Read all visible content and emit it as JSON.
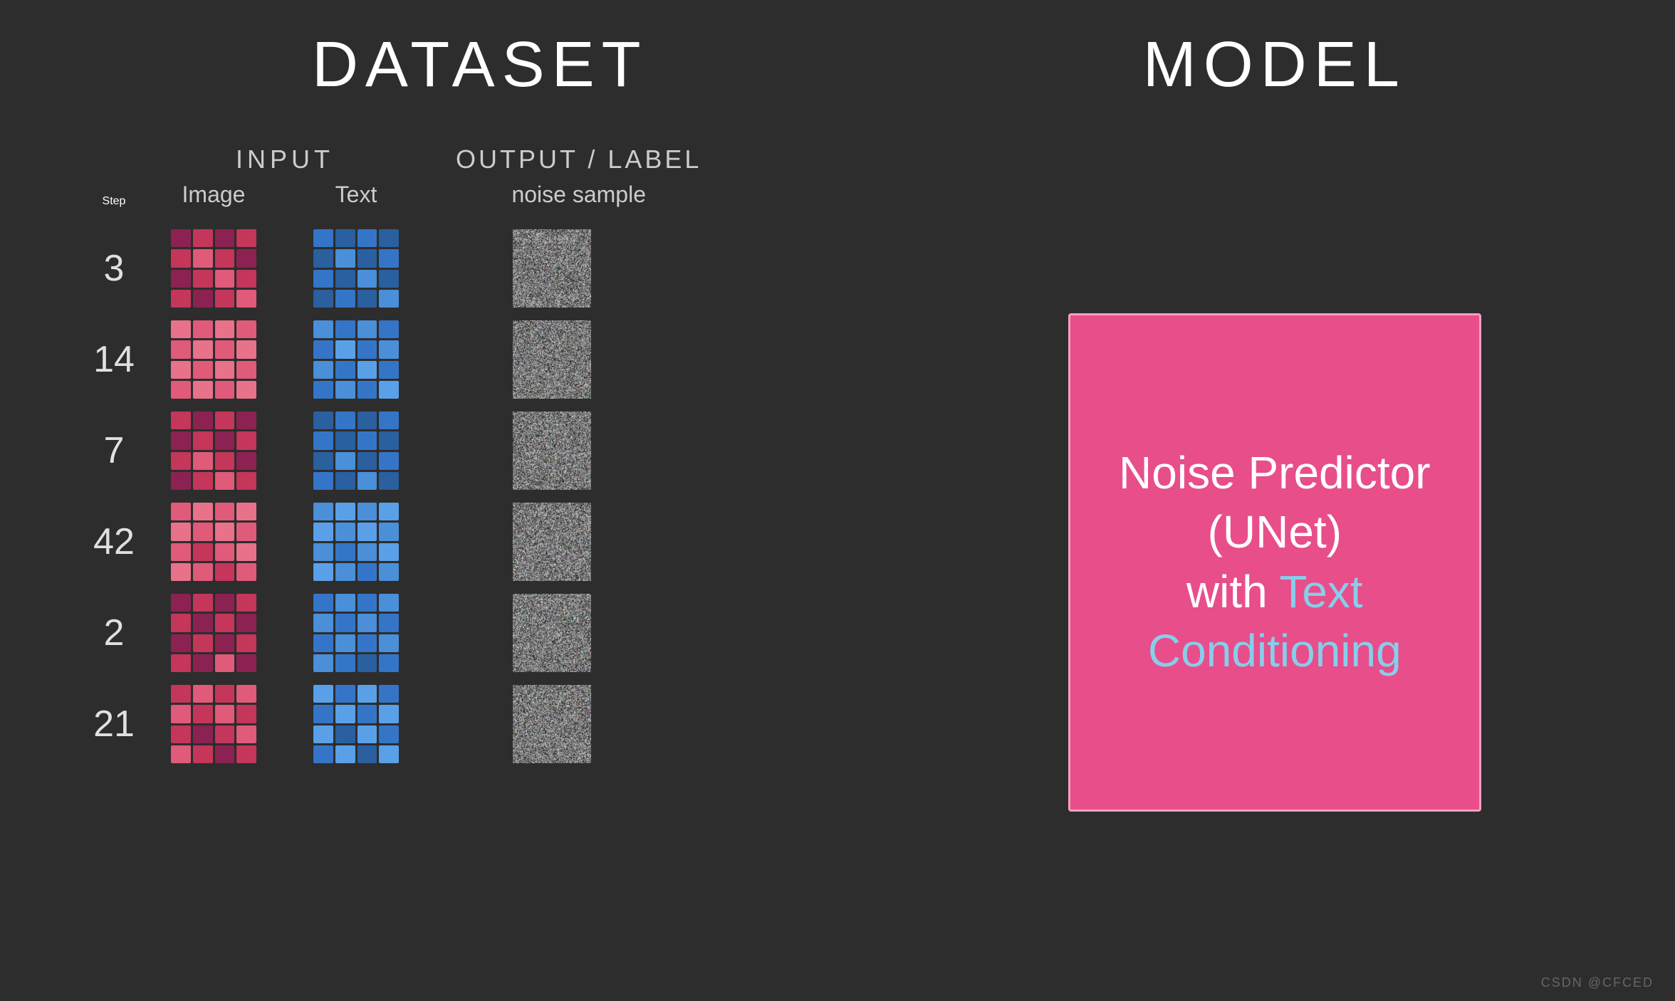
{
  "headers": {
    "dataset": "DATASET",
    "model": "MODEL"
  },
  "column_headers": {
    "input_label": "INPUT",
    "image_col": "Image",
    "text_col": "Text",
    "step_col": "Step",
    "output_label": "OUTPUT  /  LABEL",
    "noise_col": "noise sample"
  },
  "rows": [
    {
      "step": "3"
    },
    {
      "step": "14"
    },
    {
      "step": "7"
    },
    {
      "step": "42"
    },
    {
      "step": "2"
    },
    {
      "step": "21"
    }
  ],
  "model_box": {
    "line1": "Noise Predictor",
    "line2": "(UNet)",
    "line3_plain": "with ",
    "line3_highlight": "Text",
    "line4_highlight": "Conditioning"
  },
  "watermark": "CSDN @CFCED"
}
